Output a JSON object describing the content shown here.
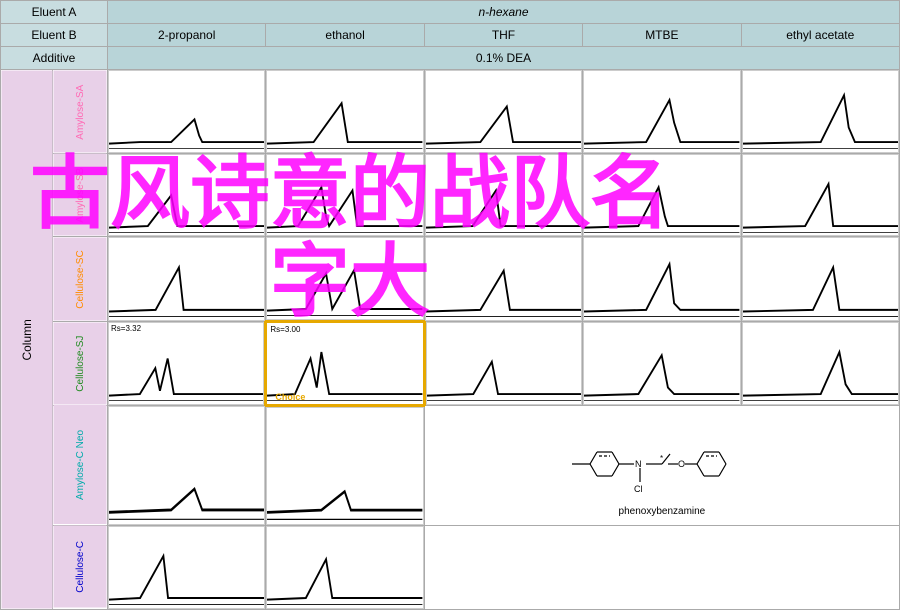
{
  "headers": {
    "eluent_a_label": "Eluent A",
    "eluent_a_value": "n-hexane",
    "eluent_b_label": "Eluent B",
    "eluent_b_cols": [
      "2-propanol",
      "ethanol",
      "THF",
      "MTBE",
      "ethyl acetate"
    ],
    "additive_label": "Additive",
    "additive_value": "0.1% DEA"
  },
  "column_label": "Column",
  "rows": [
    {
      "id": "amylose-sa",
      "label": "Amylose-SA",
      "color": "#ff69b4"
    },
    {
      "id": "amylose-sb",
      "label": "Amylose-SB",
      "color": "#ff69b4"
    },
    {
      "id": "cellulose-sc",
      "label": "Cellulose-SC",
      "color": "#ff8c00"
    },
    {
      "id": "cellulose-sj",
      "label": "Cellulose-SJ",
      "color": "#228b22"
    },
    {
      "id": "amylose-c-neo",
      "label": "Amylose-C Neo",
      "color": "#00aaaa"
    },
    {
      "id": "cellulose-c",
      "label": "Cellulose-C",
      "color": "#0000cc"
    }
  ],
  "highlighted": {
    "row": 3,
    "col": 1
  },
  "rs_values": {
    "3_0": "Rs=3.32",
    "3_1": "Rs=3.00"
  },
  "choice_label": "Choice",
  "molecule": {
    "name": "phenoxybenzamine",
    "label": "phenoxybenzamine"
  },
  "watermark": "古风诗意的战队名\n字大"
}
